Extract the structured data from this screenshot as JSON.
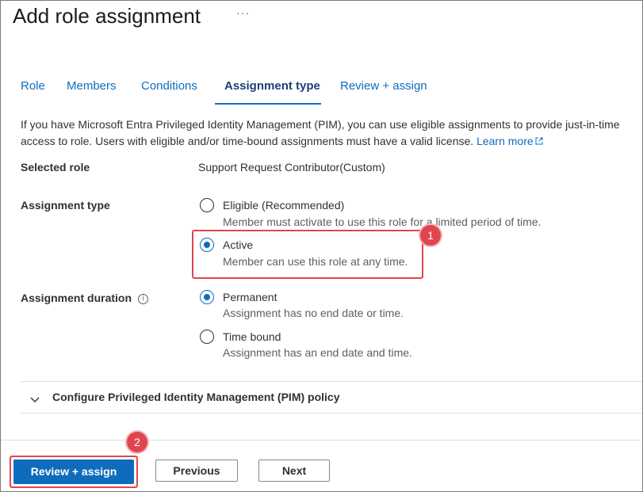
{
  "header": {
    "title": "Add role assignment",
    "more_label": "···"
  },
  "tabs": [
    {
      "label": "Role"
    },
    {
      "label": "Members"
    },
    {
      "label": "Conditions"
    },
    {
      "label": "Assignment type"
    },
    {
      "label": "Review + assign"
    }
  ],
  "active_tab": "Assignment type",
  "info": {
    "text": "If you have Microsoft Entra Privileged Identity Management (PIM), you can use eligible assignments to provide just-in-time access to role. Users with eligible and/or time-bound assignments must have a valid license. ",
    "link_label": "Learn more",
    "link_icon": "external-link-icon"
  },
  "selected_role": {
    "label": "Selected role",
    "value": "Support Request Contributor(Custom)"
  },
  "assignment_type": {
    "label": "Assignment type",
    "options": [
      {
        "label": "Eligible (Recommended)",
        "description": "Member must activate to use this role for a limited period of time.",
        "checked": false
      },
      {
        "label": "Active",
        "description": "Member can use this role at any time.",
        "checked": true
      }
    ]
  },
  "assignment_duration": {
    "label": "Assignment duration",
    "info_icon": "info-icon",
    "options": [
      {
        "label": "Permanent",
        "description": "Assignment has no end date or time.",
        "checked": true
      },
      {
        "label": "Time bound",
        "description": "Assignment has an end date and time.",
        "checked": false
      }
    ]
  },
  "pim_section": {
    "label": "Configure Privileged Identity Management (PIM) policy",
    "icon": "chevron-down-icon",
    "expanded": false
  },
  "footer": {
    "review_label": "Review + assign",
    "previous_label": "Previous",
    "next_label": "Next"
  },
  "callouts": {
    "one": "1",
    "two": "2"
  },
  "colors": {
    "accent": "#0f6cbd",
    "callout": "#e0454f"
  }
}
